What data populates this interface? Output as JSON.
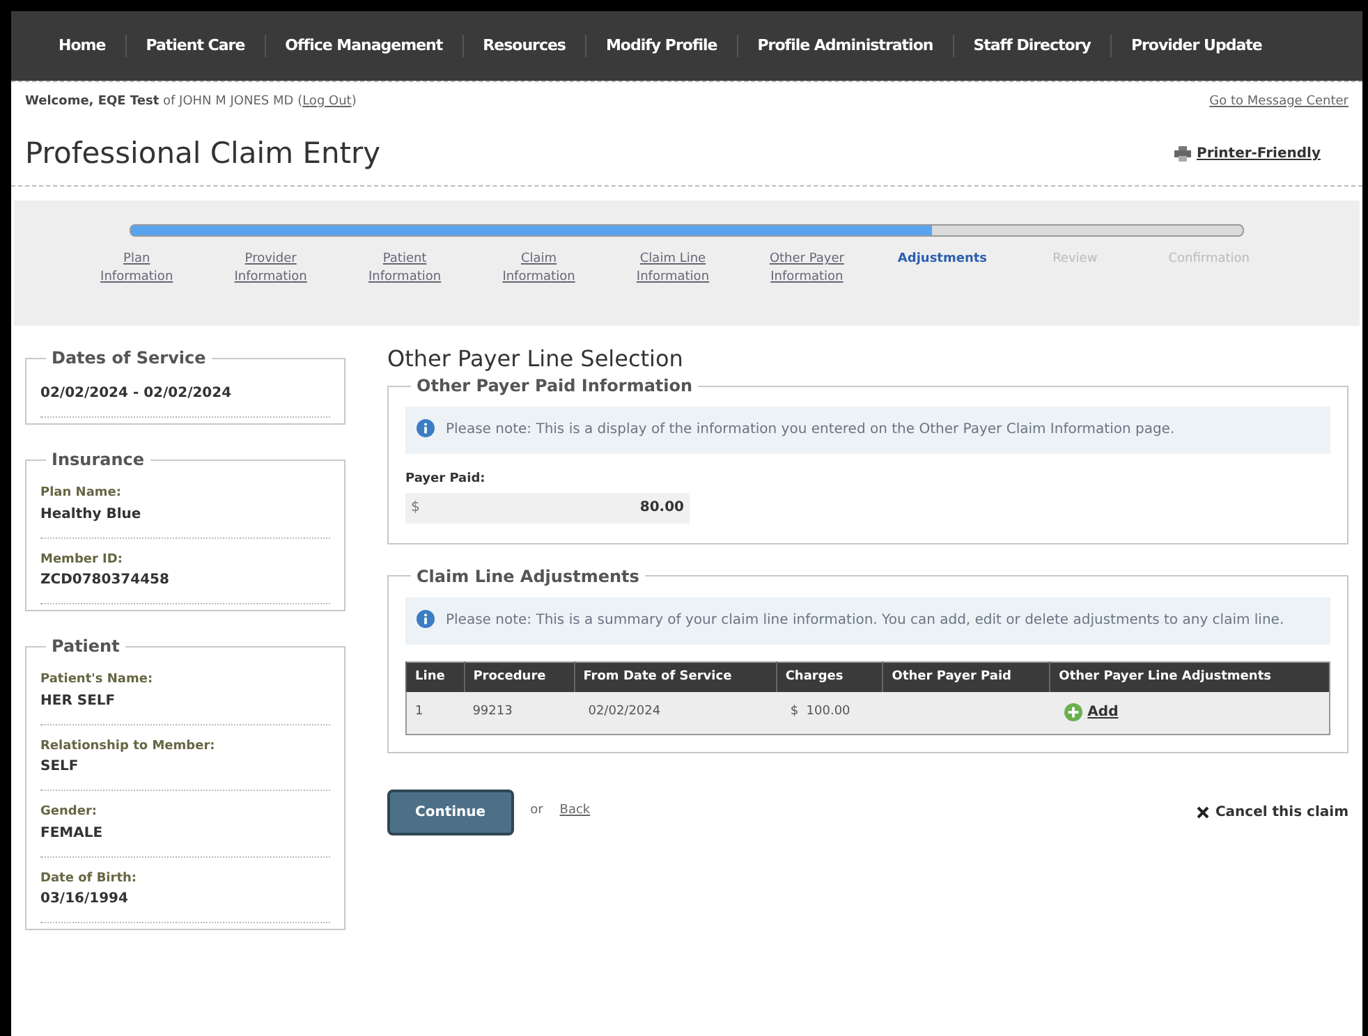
{
  "nav": [
    "Home",
    "Patient Care",
    "Office Management",
    "Resources",
    "Modify Profile",
    "Profile Administration",
    "Staff Directory",
    "Provider Update"
  ],
  "welcome": {
    "name": "Welcome, EQE Test",
    "of": "of JOHN M JONES MD (",
    "logout": "Log Out",
    "close": ")",
    "message_center": "Go to Message Center"
  },
  "page_title": "Professional Claim Entry",
  "printer_friendly": "Printer-Friendly",
  "progress": {
    "level": 0.72,
    "steps": [
      {
        "label": "Plan Information",
        "kind": "done"
      },
      {
        "label": "Provider Information",
        "kind": "done"
      },
      {
        "label": "Patient Information",
        "kind": "done"
      },
      {
        "label": "Claim Information",
        "kind": "done"
      },
      {
        "label": "Claim Line Information",
        "kind": "done"
      },
      {
        "label": "Other Payer Information",
        "kind": "done"
      },
      {
        "label": "Adjustments",
        "kind": "current"
      },
      {
        "label": "Review",
        "kind": "pending"
      },
      {
        "label": "Confirmation",
        "kind": "pending"
      }
    ]
  },
  "sidebar": [
    {
      "title": "Dates of Service",
      "fields": [
        {
          "value": "02/02/2024 - 02/02/2024"
        }
      ]
    },
    {
      "title": "Insurance",
      "fields": [
        {
          "label": "Plan Name:",
          "value": "Healthy Blue"
        },
        {
          "label": "Member ID:",
          "value": "ZCD0780374458"
        }
      ]
    },
    {
      "title": "Patient",
      "fields": [
        {
          "label": "Patient's Name:",
          "value": "HER SELF"
        },
        {
          "label": "Relationship to Member:",
          "value": "SELF"
        },
        {
          "label": "Gender:",
          "value": "FEMALE"
        },
        {
          "label": "Date of Birth:",
          "value": "03/16/1994"
        }
      ]
    }
  ],
  "section_title": "Other Payer Line Selection",
  "paid_info": {
    "title": "Other Payer Paid Information",
    "note": "Please note: This is a display of the information you entered on the Other Payer Claim Information page.",
    "field_label": "Payer Paid:",
    "currency": "$",
    "value": "80.00"
  },
  "adjustments": {
    "title": "Claim Line Adjustments",
    "note": "Please note: This is a summary of your claim line information. You can add, edit or delete adjustments to any claim line.",
    "columns": [
      "Line",
      "Procedure",
      "From Date of Service",
      "Charges",
      "Other Payer Paid",
      "Other Payer Line Adjustments"
    ],
    "rows": [
      {
        "line": "1",
        "procedure": "99213",
        "from_date": "02/02/2024",
        "currency": "$",
        "charges": "100.00",
        "action": "Add"
      }
    ]
  },
  "continue": "Continue",
  "or": "or",
  "back": "Back",
  "cancel": "Cancel this claim"
}
